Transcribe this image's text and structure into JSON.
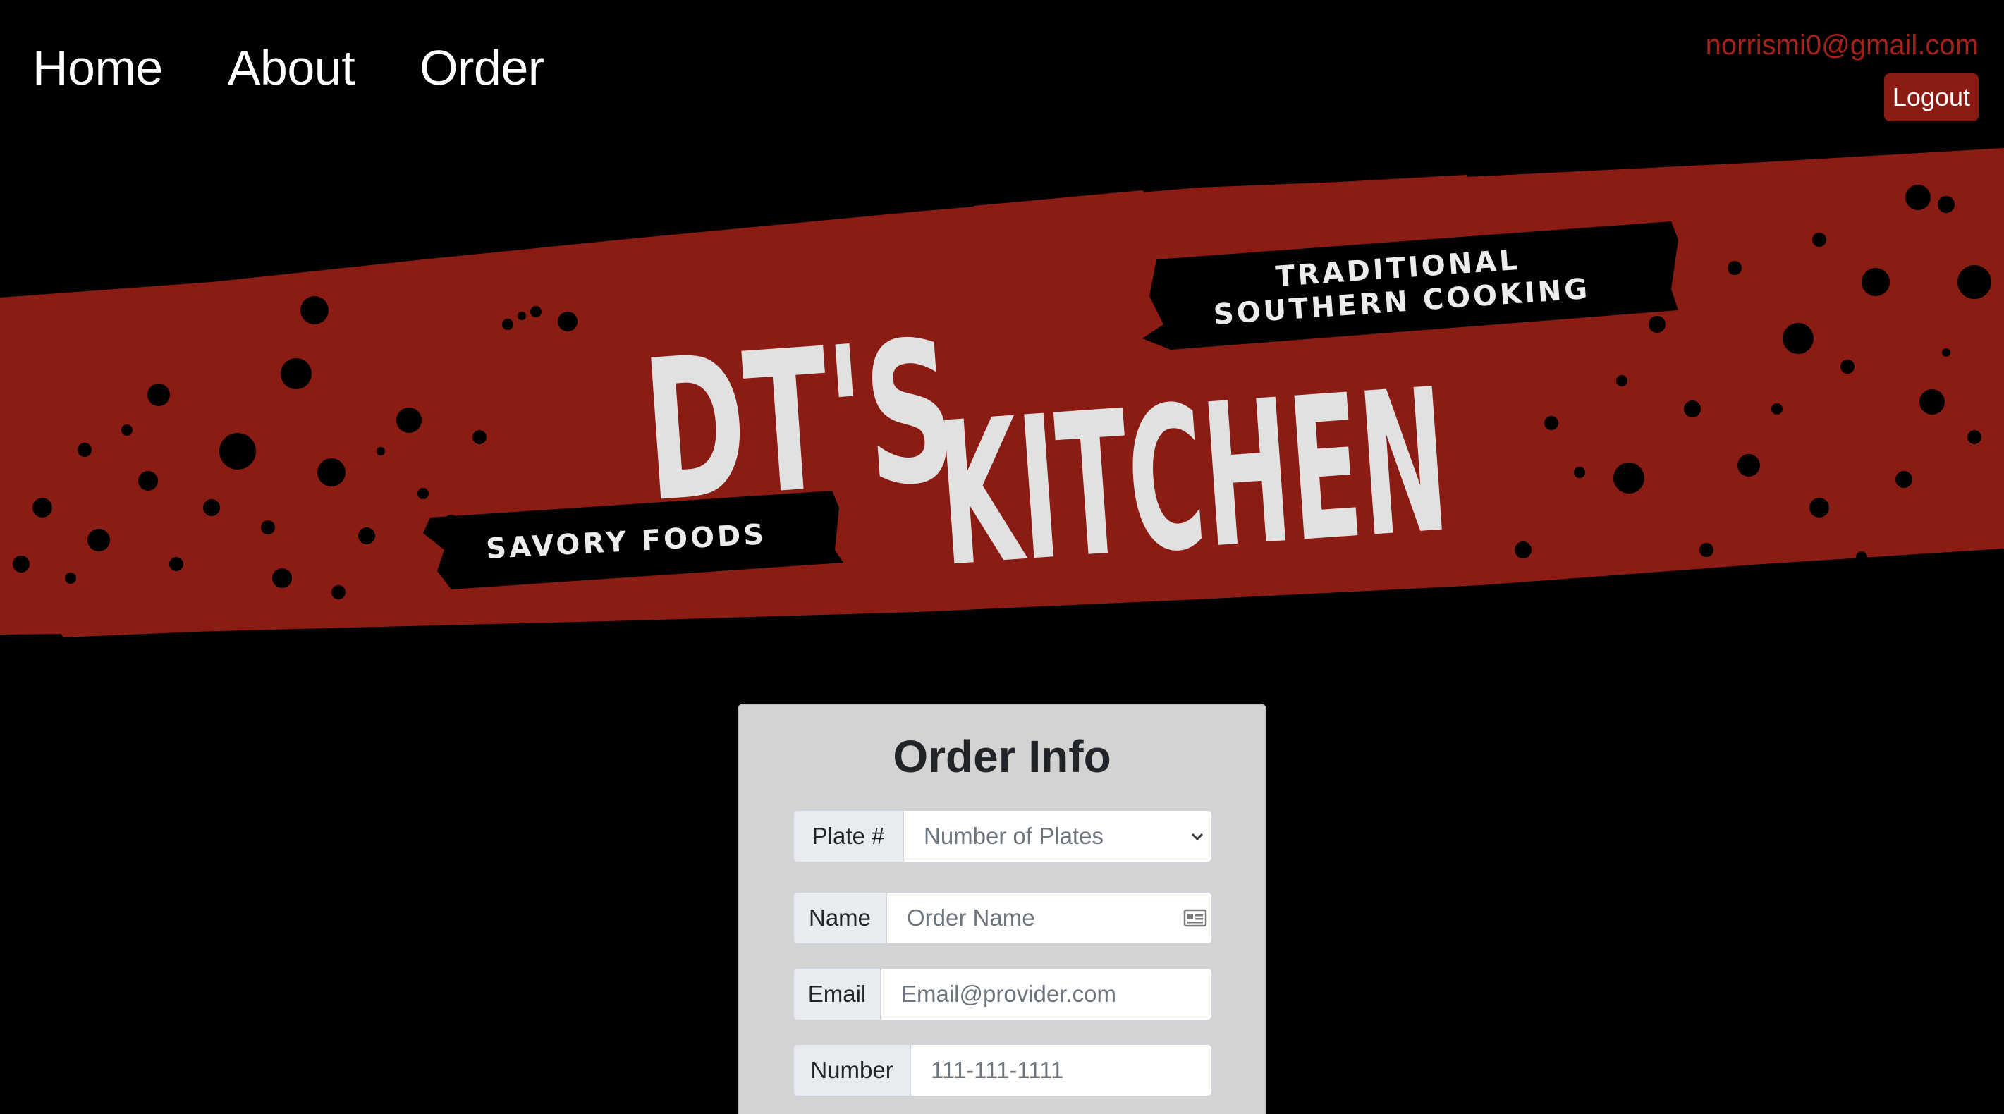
{
  "nav": {
    "items": [
      {
        "label": "Home"
      },
      {
        "label": "About"
      },
      {
        "label": "Order"
      }
    ]
  },
  "user": {
    "email": "norrismi0@gmail.com",
    "logout_label": "Logout"
  },
  "banner": {
    "title_line1": "DT'S",
    "title_line2": "KITCHEN",
    "tag_top_line1": "TRADITIONAL",
    "tag_top_line2": "SOUTHERN COOKING",
    "tag_bottom": "SAVORY FOODS",
    "colors": {
      "stripe": "#8b1c14",
      "text": "#e1e1e1"
    }
  },
  "order_form": {
    "title": "Order Info",
    "plate": {
      "label": "Plate #",
      "selected": "Number of Plates"
    },
    "name": {
      "label": "Name",
      "placeholder": "Order Name"
    },
    "email": {
      "label": "Email",
      "placeholder": "Email@provider.com"
    },
    "number": {
      "label": "Number",
      "placeholder": "111-111-1111"
    }
  },
  "colors": {
    "background": "#000000",
    "accent": "#8b1c14",
    "card": "#d3d3d3"
  }
}
